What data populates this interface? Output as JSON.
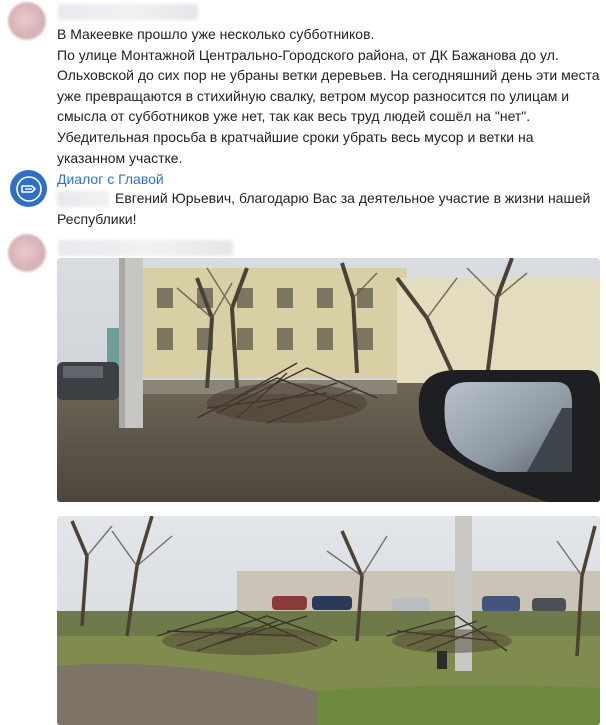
{
  "post": {
    "author_name": "",
    "lines": [
      "В Макеевке прошло уже несколько субботников.",
      "По улице Монтажной Центрально-Городского района, от ДК Бажанова до ул.",
      "Ольховской до сих пор не убраны ветки деревьев. На сегодняшний день эти места",
      "уже превращаются в стихийную свалку, ветром мусор разносится по улицам и",
      "смысла от субботников уже нет, так как весь труд людей сошёл на \"нет\".",
      "Убедительная просьба в кратчайшие сроки убрать весь мусор и ветки на",
      "указанном участке."
    ]
  },
  "reply": {
    "author": "Диалог с Главой",
    "line1": "Евгений Юрьевич, благодарю Вас за деятельное участие в жизни нашей",
    "line2": "Республики!"
  },
  "photos": [
    {
      "icon": "photo-branches-pile-with-car-mirror"
    },
    {
      "icon": "photo-branches-pile-park-lot"
    }
  ],
  "colors": {
    "accent": "#2f74c6",
    "gov_avatar": "#2f6fc9"
  }
}
